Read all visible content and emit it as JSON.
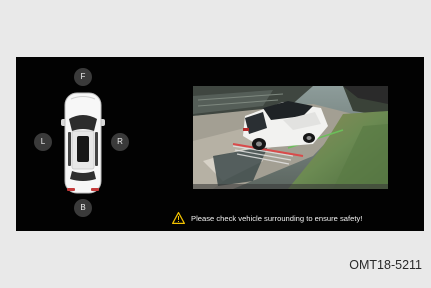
{
  "views": {
    "front_label": "F",
    "left_label": "L",
    "right_label": "R",
    "back_label": "B"
  },
  "warning": {
    "text": "Please check vehicle surrounding to ensure safety!",
    "icon": "warning-triangle-icon"
  },
  "doc_code": "OMT18-5211",
  "colors": {
    "screen_bg": "#020202",
    "button_bg": "#3a3a3a",
    "warning_yellow": "#f2c200",
    "page_bg": "#e9e9e9"
  }
}
